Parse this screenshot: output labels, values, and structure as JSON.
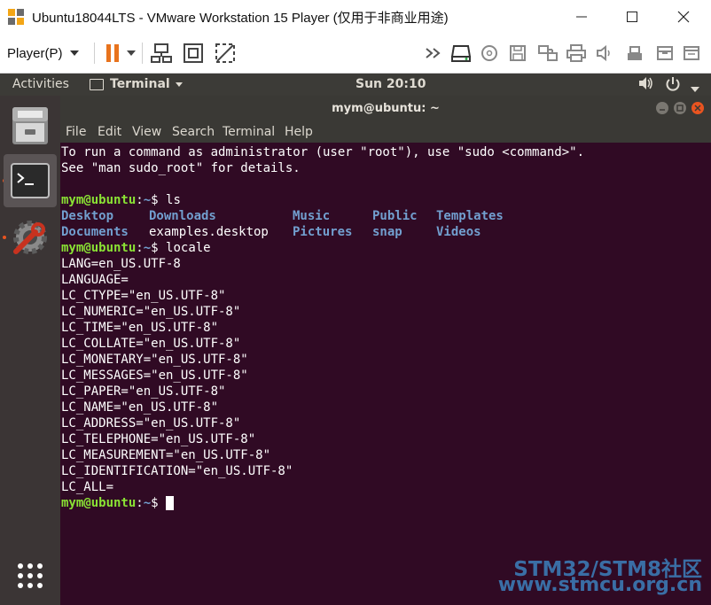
{
  "window": {
    "title": "Ubuntu18044LTS - VMware Workstation 15 Player (仅用于非商业用途)",
    "controls": {
      "minimize": "—",
      "maximize": "☐",
      "close": "✕"
    }
  },
  "toolbar": {
    "player_label": "Player(P)",
    "icons": [
      "pause-icon",
      "dropdown-caret-icon",
      "network-send-keys-icon",
      "fullscreen-icon",
      "unity-icon",
      "forward-icon",
      "hard-disk-icon",
      "cd-dvd-icon",
      "floppy-icon",
      "network-adapter-icon",
      "printer-icon",
      "sound-icon",
      "usb-device-icon",
      "tray-icon",
      "message-log-icon"
    ]
  },
  "ubuntu_bar": {
    "activities": "Activities",
    "app_name": "Terminal",
    "clock": "Sun 20:10"
  },
  "terminal": {
    "title": "mym@ubuntu: ~",
    "menu": [
      "File",
      "Edit",
      "View",
      "Search",
      "Terminal",
      "Help"
    ],
    "intro": [
      "To run a command as administrator (user \"root\"), use \"sudo <command>\".",
      "See \"man sudo_root\" for details."
    ],
    "prompt_user": "mym@ubuntu",
    "prompt_sep": ":",
    "prompt_path": "~",
    "prompt_end": "$ ",
    "cmd_ls": "ls",
    "ls_rows": [
      [
        "Desktop",
        "Downloads",
        "Music",
        "Public",
        "Templates"
      ],
      [
        "Documents",
        "examples.desktop",
        "Pictures",
        "snap",
        "Videos"
      ]
    ],
    "cmd_locale": "locale",
    "locale_output": [
      "LANG=en_US.UTF-8",
      "LANGUAGE=",
      "LC_CTYPE=\"en_US.UTF-8\"",
      "LC_NUMERIC=\"en_US.UTF-8\"",
      "LC_TIME=\"en_US.UTF-8\"",
      "LC_COLLATE=\"en_US.UTF-8\"",
      "LC_MONETARY=\"en_US.UTF-8\"",
      "LC_MESSAGES=\"en_US.UTF-8\"",
      "LC_PAPER=\"en_US.UTF-8\"",
      "LC_NAME=\"en_US.UTF-8\"",
      "LC_ADDRESS=\"en_US.UTF-8\"",
      "LC_TELEPHONE=\"en_US.UTF-8\"",
      "LC_MEASUREMENT=\"en_US.UTF-8\"",
      "LC_IDENTIFICATION=\"en_US.UTF-8\"",
      "LC_ALL="
    ]
  },
  "watermark": {
    "line1": "STM32/STM8社区",
    "line2": "www.stmcu.org.cn"
  },
  "colors": {
    "terminal_bg": "#300a24",
    "prompt_user": "#8ae234",
    "directory": "#729fcf",
    "ubuntu_orange": "#e95420"
  }
}
